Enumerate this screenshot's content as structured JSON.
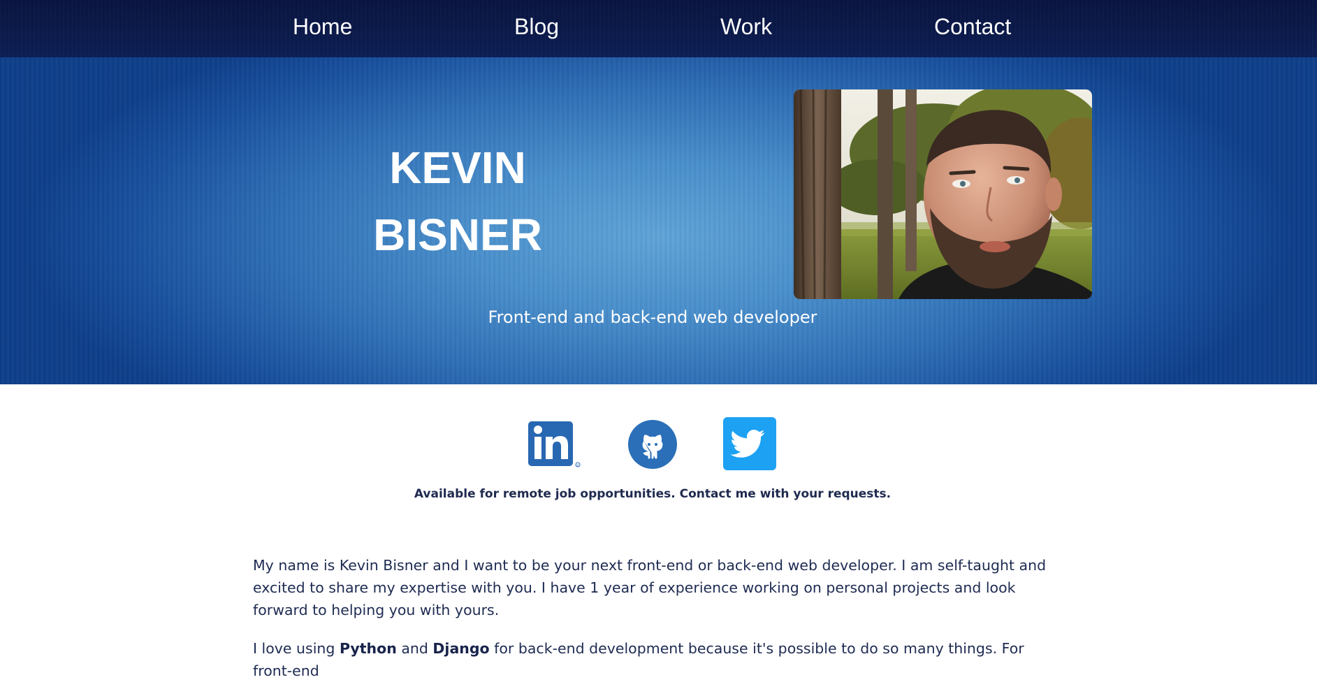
{
  "nav": {
    "home": "Home",
    "blog": "Blog",
    "work": "Work",
    "contact": "Contact"
  },
  "hero": {
    "first_name": "KEVIN",
    "last_name": "BISNER",
    "tagline": "Front-end and back-end web developer",
    "photo_icon": "portrait-photo"
  },
  "social": {
    "linkedin": {
      "icon": "linkedin-icon",
      "color": "#2867b2"
    },
    "github": {
      "icon": "github-icon",
      "color": "#2a6fb8"
    },
    "twitter": {
      "icon": "twitter-icon",
      "color": "#1da1f2"
    }
  },
  "availability": "Available for remote job opportunities. Contact me with your requests.",
  "bio": {
    "paragraph1": "My name is Kevin Bisner and I want to be your next front-end or back-end web developer. I am self-taught and excited to share my expertise with you. I have 1 year of experience working on personal projects and look forward to helping you with yours.",
    "p2_start": "I love using ",
    "p2_python": "Python",
    "p2_and": " and ",
    "p2_django": "Django",
    "p2_rest": " for back-end development because it's possible to do so many things. For front-end"
  },
  "colors": {
    "nav_bg": "#0b1a4a",
    "hero_center": "#5fa3d6",
    "hero_edge": "#0f3f8a",
    "text_dark": "#1e2b52"
  }
}
